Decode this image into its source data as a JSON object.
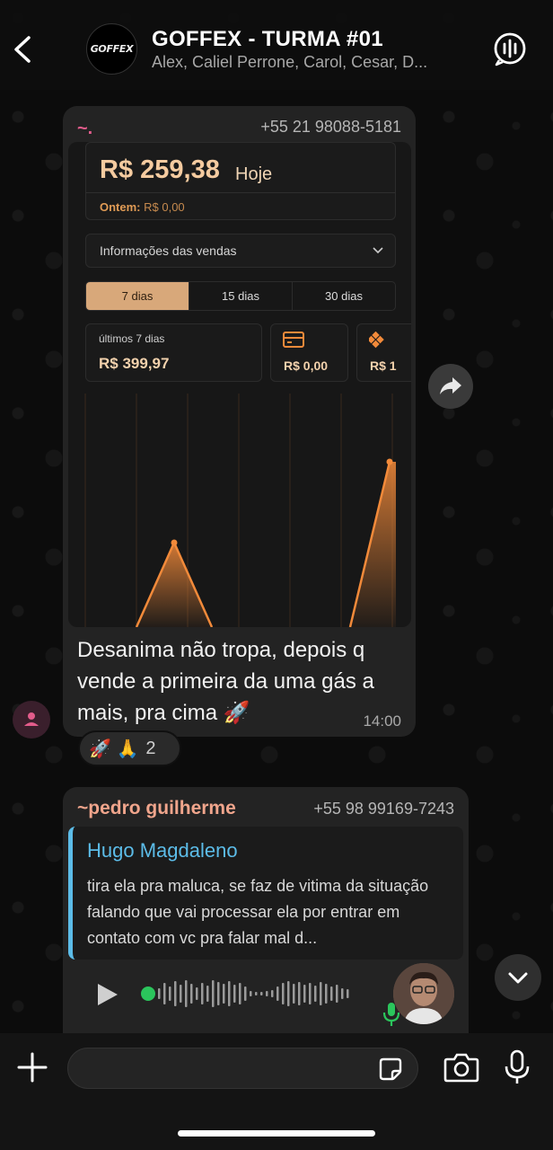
{
  "header": {
    "group_name": "GOFFEX - TURMA #01",
    "members": "Alex, Caliel Perrone, Carol, Cesar, D...",
    "avatar_text": "GOFFEX"
  },
  "message1": {
    "sender": "~.",
    "phone": "+55 21 98088-5181",
    "screenshot": {
      "today_amount": "R$ 259,38",
      "today_label": "Hoje",
      "yesterday_label": "Ontem:",
      "yesterday_value": "R$ 0,00",
      "select_label": "Informações das vendas",
      "tabs": [
        "7 dias",
        "15 dias",
        "30 dias"
      ],
      "stat_label": "últimos 7 dias",
      "stat_value": "R$ 399,97",
      "card_value": "R$ 0,00",
      "pix_value": "R$ 1"
    },
    "text": "Desanima não tropa, depois q vende a primeira da uma gás a mais, pra cima 🚀",
    "time": "14:00",
    "reactions": "🚀 🙏",
    "reaction_count": "2"
  },
  "message2": {
    "sender": "~pedro guilherme",
    "phone": "+55 98 99169-7243",
    "quote_name": "Hugo Magdaleno",
    "quote_text": "tira ela pra maluca, se faz de vitima da situação falando que vai processar ela por entrar em contato com vc pra falar mal d..."
  },
  "colors": {
    "accent_orange": "#f28a3a",
    "quote_blue": "#5cbce8",
    "sender1": "#e25c8b",
    "sender2": "#f0a58c"
  }
}
